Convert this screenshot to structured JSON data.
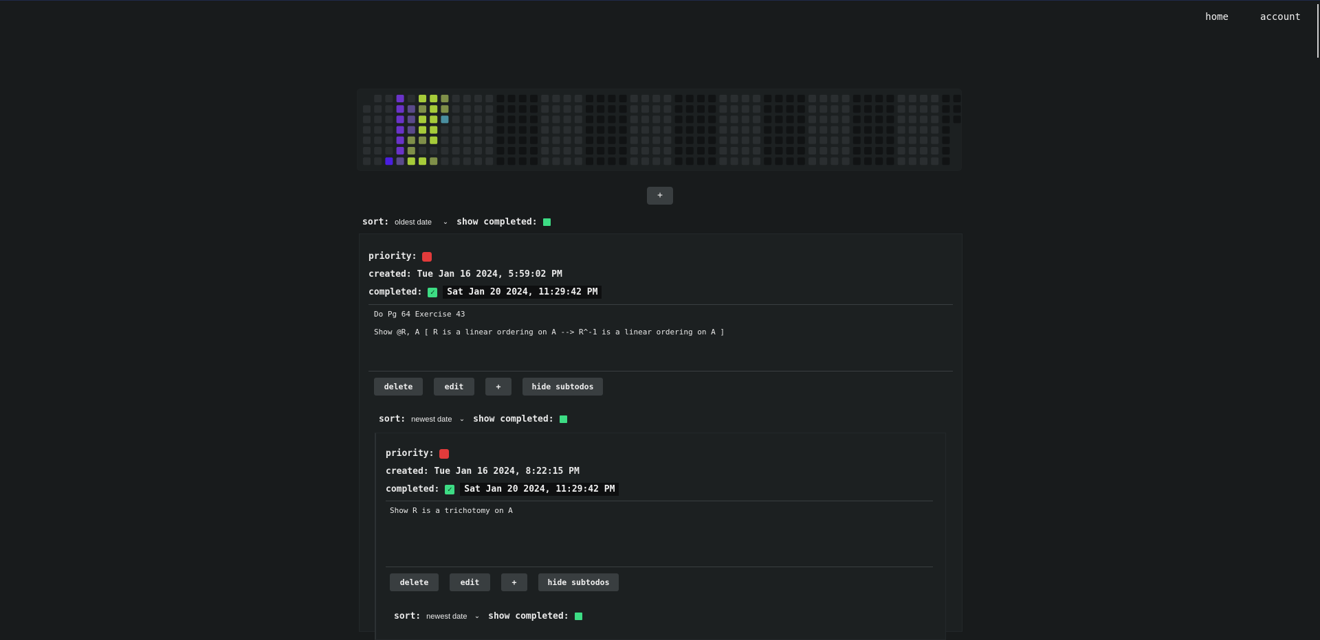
{
  "nav": {
    "home": "home",
    "account": "account"
  },
  "heatmap": {
    "colors": {
      "empty_light": "#2a2e30",
      "empty_dark": "#111314",
      "purple": "#6a33c8",
      "purple_muted": "#5a4a8a",
      "blue_purple": "#4a1ee0",
      "green": "#a6cb3a",
      "olive": "#7f8f49",
      "teal": "#4a8fa0"
    }
  },
  "add_button": {
    "label": "+"
  },
  "top_sort": {
    "label": "sort:",
    "value": "oldest date",
    "show_completed_label": "show completed:"
  },
  "todo": {
    "priority_label": "priority:",
    "created_label": "created:",
    "created_value": "Tue Jan 16 2024, 5:59:02 PM",
    "completed_label": "completed:",
    "completed_value": "Sat Jan 20 2024, 11:29:42 PM",
    "lines": [
      "Do Pg 64 Exercise 43",
      "Show @R, A [ R is a linear ordering on A --> R^-1 is a linear ordering on A ]"
    ],
    "buttons": {
      "delete": "delete",
      "edit": "edit",
      "add": "+",
      "hide": "hide subtodos"
    }
  },
  "sub_sort": {
    "label": "sort:",
    "value": "newest date",
    "show_completed_label": "show completed:"
  },
  "subtodo": {
    "priority_label": "priority:",
    "created_label": "created:",
    "created_value": "Tue Jan 16 2024, 8:22:15 PM",
    "completed_label": "completed:",
    "completed_value": "Sat Jan 20 2024, 11:29:42 PM",
    "lines": [
      "Show R is a trichotomy on A"
    ],
    "buttons": {
      "delete": "delete",
      "edit": "edit",
      "add": "+",
      "hide": "hide subtodos"
    }
  },
  "sub_sort2": {
    "label": "sort:",
    "value": "newest date",
    "show_completed_label": "show completed:"
  }
}
